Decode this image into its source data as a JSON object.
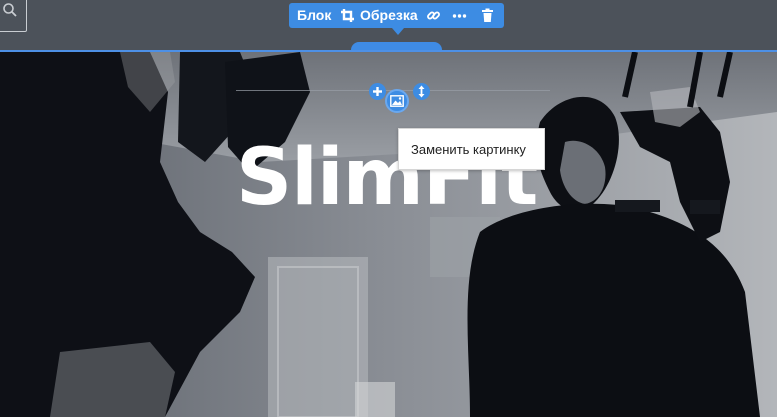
{
  "toolbar": {
    "block_label": "Блок",
    "crop_label": "Обрезка",
    "icons": [
      "crop-icon",
      "link-icon",
      "more-icon",
      "trash-icon"
    ],
    "accent": "#3d8ce3"
  },
  "hero": {
    "title": "SlimFit",
    "title_color": "#ffffff"
  },
  "block_controls": {
    "icons": [
      "add-icon",
      "image-icon",
      "resize-vertical-icon"
    ]
  },
  "tooltip": {
    "text": "Заменить картинку"
  },
  "search": {
    "icon": "search-icon"
  }
}
